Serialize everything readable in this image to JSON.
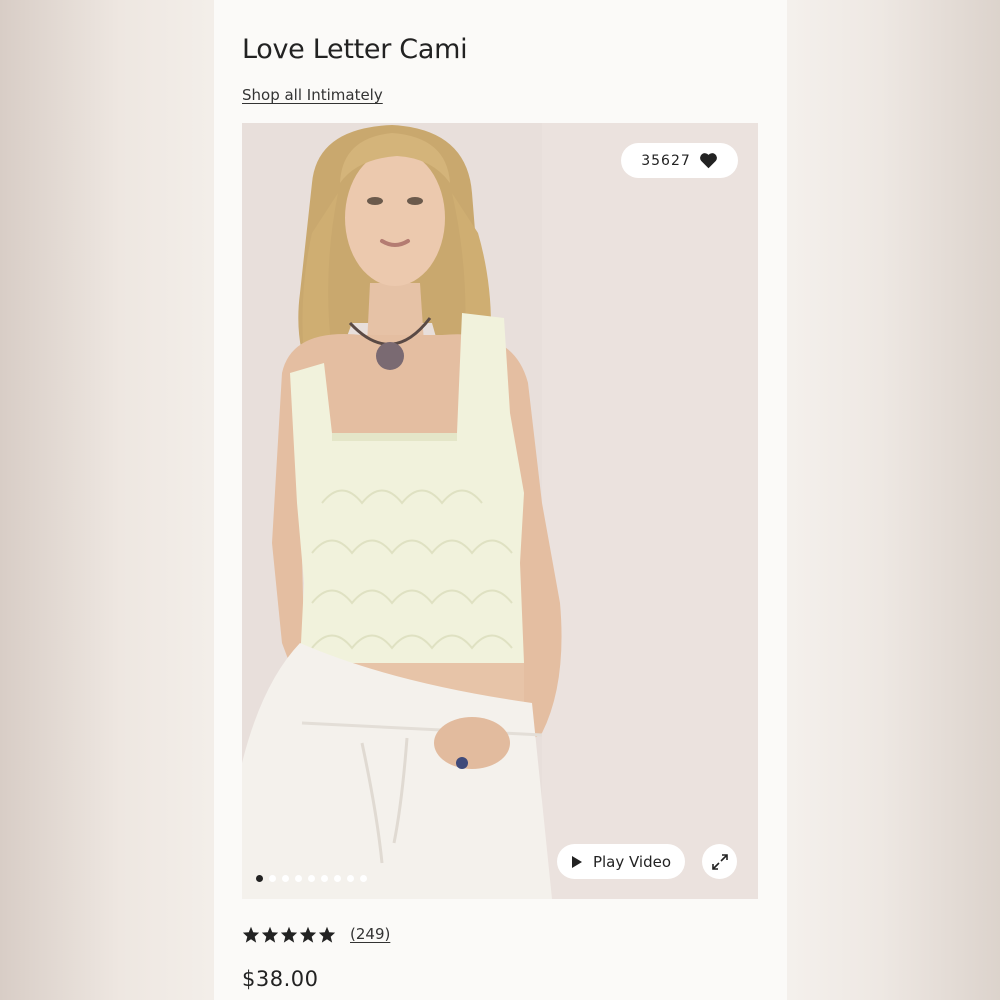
{
  "product": {
    "title": "Love Letter Cami",
    "shop_link": "Shop all Intimately",
    "likes": "35627",
    "price": "$38.00",
    "rating": 5,
    "review_count": "(249)"
  },
  "media": {
    "play_video_label": "Play Video",
    "image_count": 9,
    "active_index": 0
  },
  "icons": {
    "likes": "heart-icon",
    "video": "play-icon",
    "expand": "expand-icon",
    "rating": "star-icon"
  },
  "colors": {
    "text": "#222222",
    "panel_background": "#fbfaf8",
    "pill_background": "#ffffff",
    "cami": "#f1f2dc",
    "skirt": "#f4f1ec"
  }
}
